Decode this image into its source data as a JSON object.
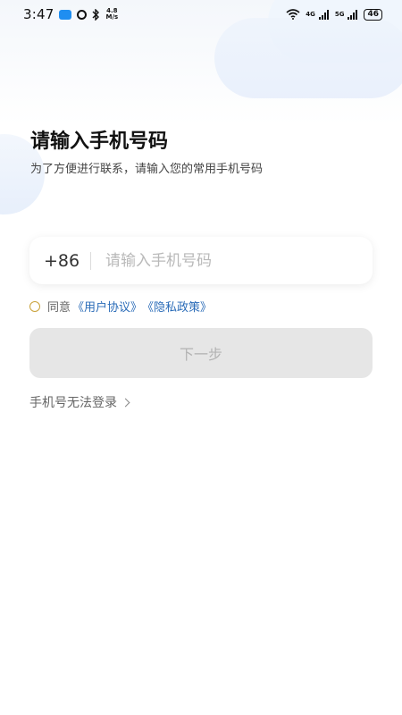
{
  "status_bar": {
    "time": "3:47",
    "net_speed_value": "4.8",
    "net_speed_unit": "M/s",
    "network_1": "4G",
    "network_2": "5G",
    "battery": "46"
  },
  "page": {
    "title": "请输入手机号码",
    "subtitle": "为了方便进行联系，请输入您的常用手机号码"
  },
  "phone": {
    "country_code": "+86",
    "placeholder": "请输入手机号码",
    "value": ""
  },
  "agreement": {
    "prefix": "同意",
    "user_agreement": "《用户协议》",
    "privacy_policy": "《隐私政策》",
    "checked": false
  },
  "next_button": {
    "label": "下一步",
    "enabled": false
  },
  "help_link": {
    "label": "手机号无法登录"
  },
  "colors": {
    "link": "#2b6cb8",
    "radio_ring": "#c9a23a",
    "button_disabled_bg": "#e6e6e6"
  },
  "icons": [
    "message-icon",
    "alarm-icon",
    "bluetooth-icon",
    "wifi-icon",
    "signal-icon",
    "battery-icon",
    "chevron-right-icon"
  ]
}
